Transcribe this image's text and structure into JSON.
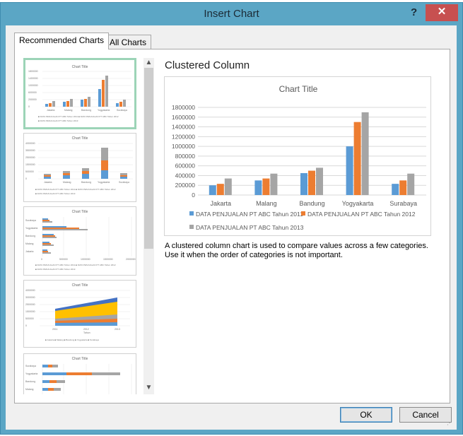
{
  "dialog": {
    "title": "Insert Chart",
    "help_label": "?",
    "close_label": "✕"
  },
  "tabs": [
    {
      "label": "Recommended Charts",
      "active": true
    },
    {
      "label": "All Charts",
      "active": false
    }
  ],
  "preview": {
    "heading": "Clustered Column",
    "description_line1": "A clustered column chart is used to compare values across a few categories.",
    "description_line2": "Use it when the order of categories is not important."
  },
  "buttons": {
    "ok": "OK",
    "cancel": "Cancel"
  },
  "colors": {
    "series2011": "#5b9bd5",
    "series2012": "#ed7d31",
    "series2013": "#a5a5a5",
    "accent_selected": "#9cd4b7",
    "title_bar": "#5ba6c5"
  },
  "chart_data": {
    "type": "bar",
    "title": "Chart Title",
    "categories": [
      "Jakarta",
      "Malang",
      "Bandung",
      "Yogyakarta",
      "Surabaya"
    ],
    "series": [
      {
        "name": "DATA PENJUALAN PT ABC Tahun 2011",
        "values": [
          200000,
          300000,
          450000,
          1000000,
          230000
        ]
      },
      {
        "name": "DATA PENJUALAN PT ABC Tahun 2012",
        "values": [
          230000,
          340000,
          500000,
          1500000,
          300000
        ]
      },
      {
        "name": "DATA PENJUALAN PT ABC Tahun 2013",
        "values": [
          340000,
          440000,
          560000,
          1700000,
          440000
        ]
      }
    ],
    "yticks": [
      "0",
      "200000",
      "400000",
      "600000",
      "800000",
      "1000000",
      "1200000",
      "1400000",
      "1600000",
      "1800000"
    ],
    "ylim": [
      0,
      1800000
    ],
    "legend": "bottom",
    "grid": true
  }
}
